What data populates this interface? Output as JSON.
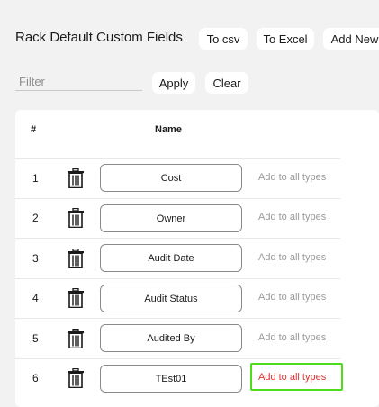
{
  "header": {
    "title": "Rack Default Custom Fields",
    "to_csv_label": "To csv",
    "to_excel_label": "To Excel",
    "add_new_label": "Add New"
  },
  "filter": {
    "placeholder": "Filter",
    "value": "",
    "apply_label": "Apply",
    "clear_label": "Clear"
  },
  "table": {
    "columns": [
      "#",
      "Name"
    ],
    "rows": [
      {
        "num": "1",
        "name": "Cost",
        "action": "Add to all types"
      },
      {
        "num": "2",
        "name": "Owner",
        "action": "Add to all types"
      },
      {
        "num": "3",
        "name": "Audit Date",
        "action": "Add to all types"
      },
      {
        "num": "4",
        "name": "Audit Status",
        "action": "Add to all types"
      },
      {
        "num": "5",
        "name": "Audited By",
        "action": "Add to all types"
      },
      {
        "num": "6",
        "name": "TEst01",
        "action": "Add to all types"
      }
    ]
  },
  "colors": {
    "background": "#f2f2f2",
    "link_inactive": "#9a9a9a",
    "link_active": "#e03131",
    "highlight": "#4cdc1c"
  },
  "icons": {
    "row_delete": "trash-icon"
  }
}
